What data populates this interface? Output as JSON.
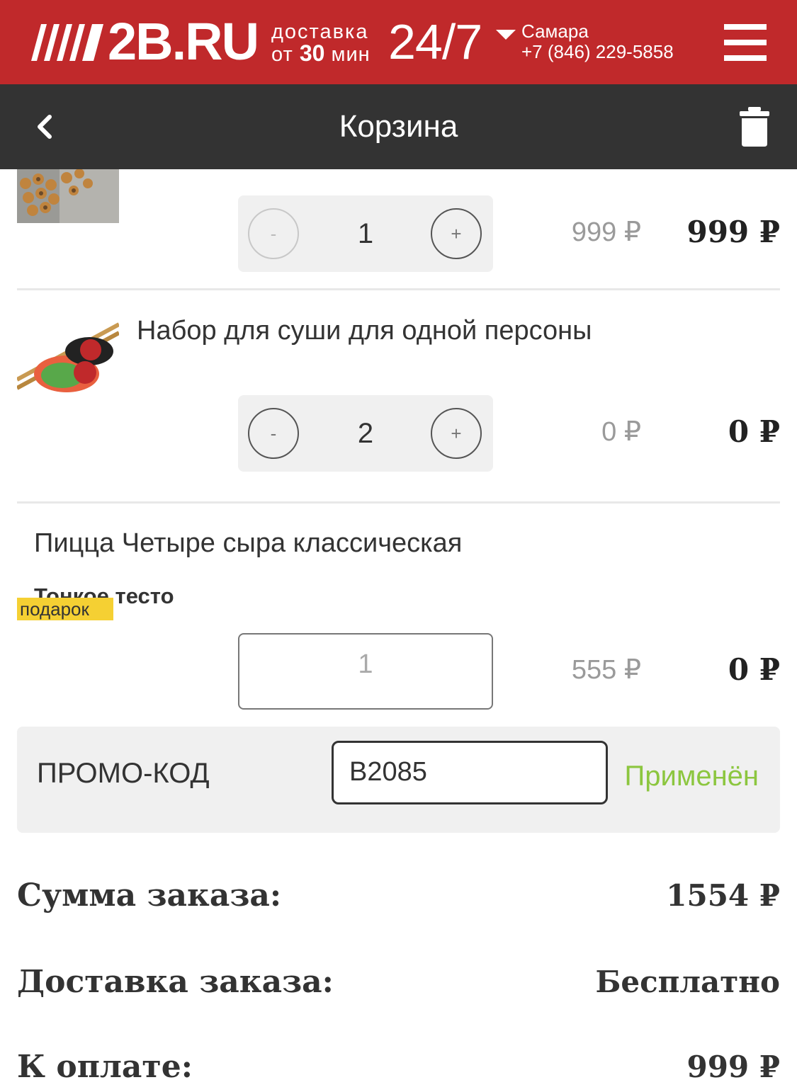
{
  "header": {
    "logo": "2B.RU",
    "delivery_line1": "доставка",
    "delivery_prefix": "от",
    "delivery_time": "30",
    "delivery_unit": "мин",
    "hours": "24/7",
    "city": "Самара",
    "phone": "+7 (846) 229-5858"
  },
  "page": {
    "title": "Корзина"
  },
  "cart": {
    "items": [
      {
        "name": "",
        "quantity": "1",
        "old_price": "999 ₽",
        "price": "999 ₽"
      },
      {
        "name": "Набор для суши для одной персоны",
        "quantity": "2",
        "old_price": "0 ₽",
        "price": "0 ₽"
      },
      {
        "name": "Пицца Четыре сыра классическая",
        "variant": "Тонкое тесто",
        "badge": "подарок",
        "quantity": "1",
        "old_price": "555 ₽",
        "price": "0 ₽"
      }
    ],
    "minus_label": "-",
    "plus_label": "+"
  },
  "promo": {
    "label": "ПРОМО-КОД",
    "value": "B2085",
    "status": "Применён"
  },
  "totals": {
    "order_sum_label": "Сумма заказа:",
    "order_sum_value": "1554 ₽",
    "delivery_label": "Доставка заказа:",
    "delivery_value": "Бесплатно",
    "to_pay_label": "К оплате:",
    "to_pay_value": "999 ₽"
  },
  "colors": {
    "brand_red": "#c0292b",
    "header_dark": "#333333",
    "status_green": "#8cc63f",
    "gift_yellow": "#f5d033"
  }
}
